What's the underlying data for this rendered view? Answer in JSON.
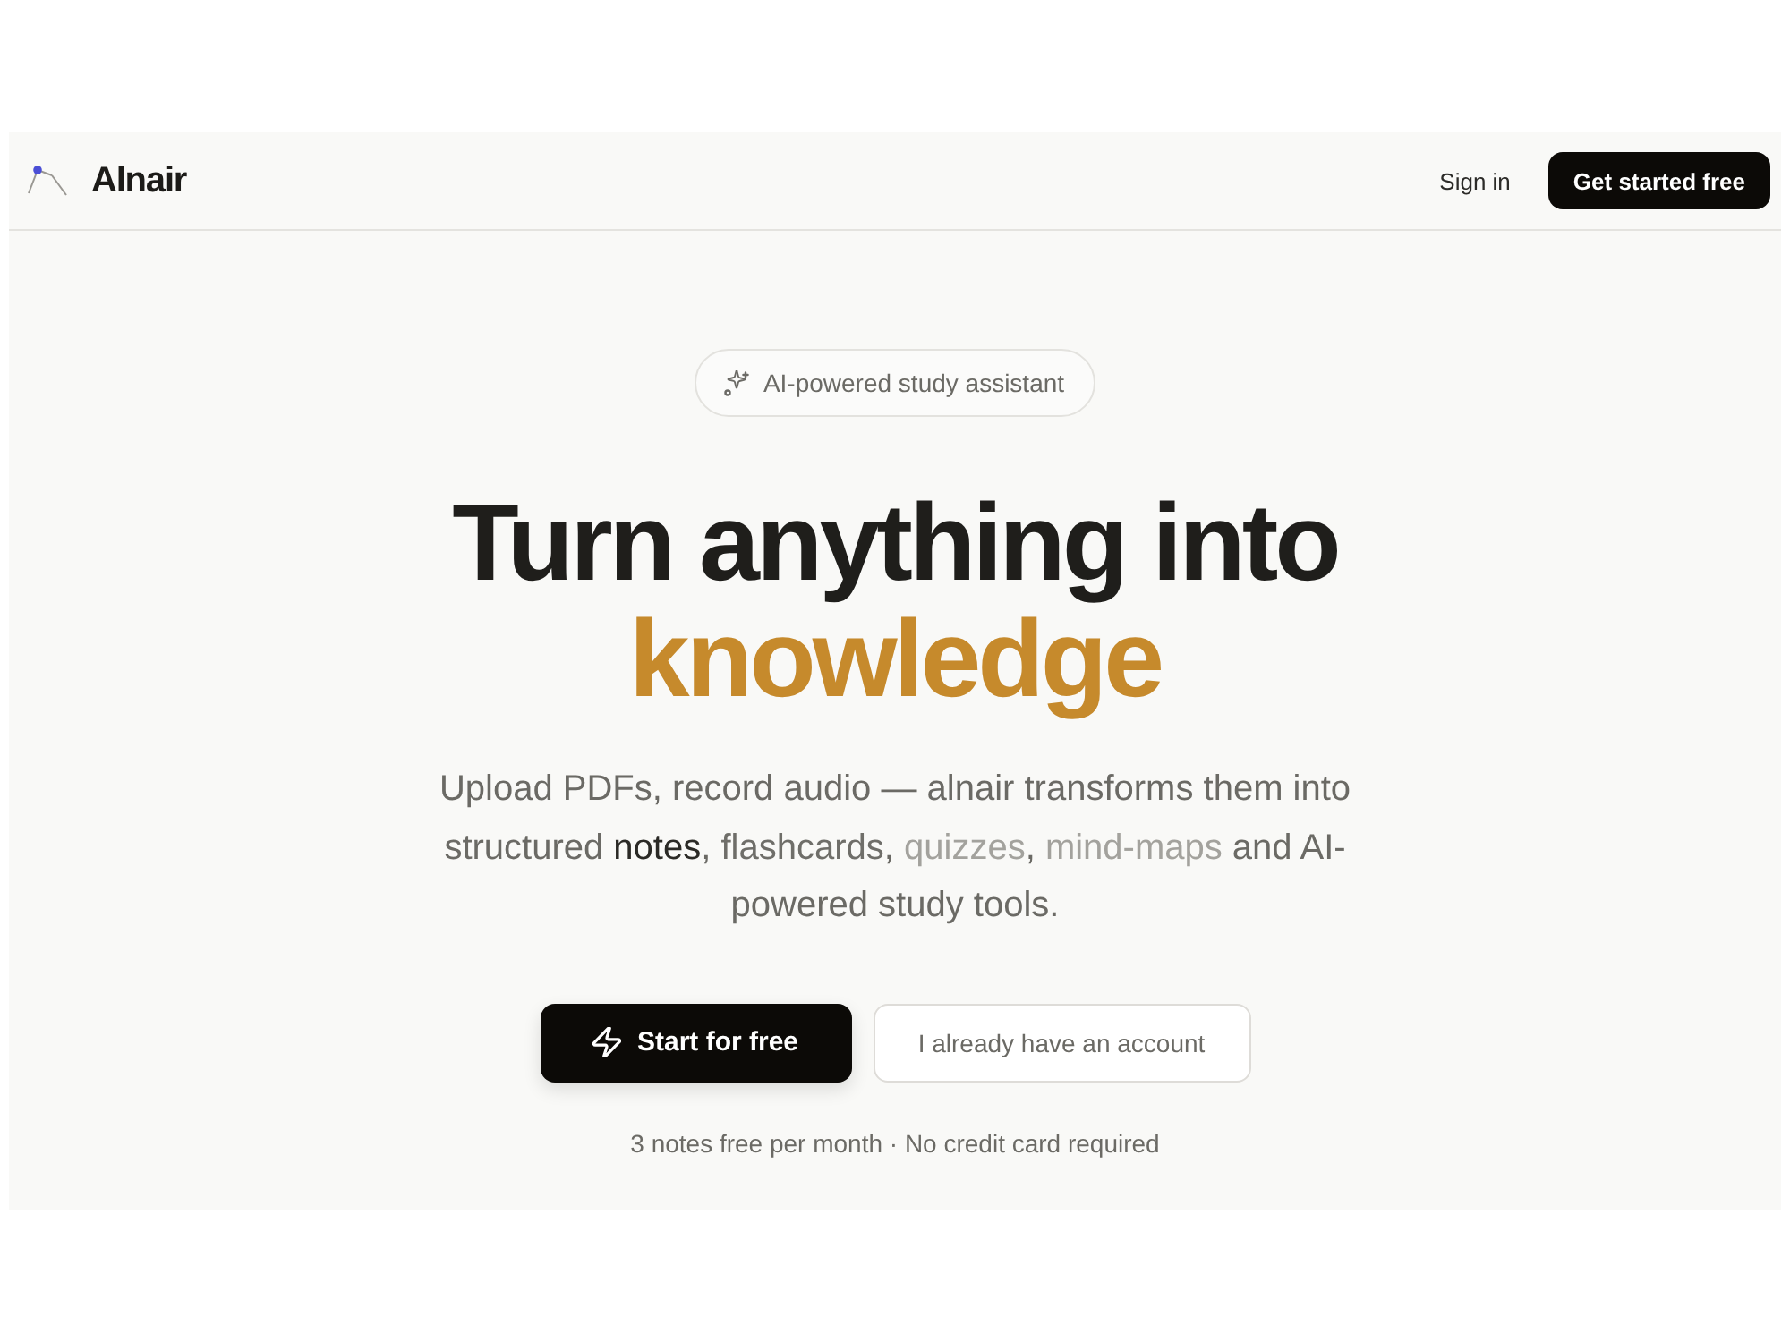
{
  "nav": {
    "brand": "Alnair",
    "sign_in": "Sign in",
    "cta": "Get started free"
  },
  "hero": {
    "badge": "AI-powered study assistant",
    "title_lines": [
      {
        "text": "Turn anything into",
        "kind": "plain"
      },
      {
        "text": "knowledge",
        "kind": "accent"
      }
    ],
    "subtitle": [
      {
        "text": "Upload PDFs, record audio — alnair transforms them into structured ",
        "kind": "plain"
      },
      {
        "text": "notes",
        "kind": "word",
        "color": "#2b2a26"
      },
      {
        "text": ", ",
        "kind": "plain"
      },
      {
        "text": "flashcards",
        "kind": "word",
        "color": "#6f6e69"
      },
      {
        "text": ", ",
        "kind": "plain"
      },
      {
        "text": "quizzes",
        "kind": "word",
        "color": "#a3a29d"
      },
      {
        "text": ", ",
        "kind": "plain"
      },
      {
        "text": "mind-maps",
        "kind": "word",
        "color": "#a3a29d"
      },
      {
        "text": " and AI-powered study tools.",
        "kind": "plain"
      }
    ],
    "primary_button": "Start for free",
    "secondary_button": "I already have an account",
    "note": "3 notes free per month · No credit card required"
  }
}
